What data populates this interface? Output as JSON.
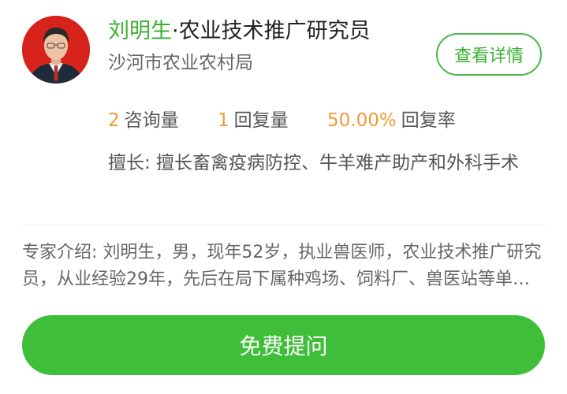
{
  "expert": {
    "name": "刘明生",
    "title": "·农业技术推广研究员",
    "organization": "沙河市农业农村局",
    "detail_button_label": "查看详情"
  },
  "stats": [
    {
      "value": "2",
      "label": "咨询量"
    },
    {
      "value": "1",
      "label": "回复量"
    },
    {
      "value": "50.00%",
      "label": "回复率"
    }
  ],
  "specialty": "擅长: 擅长畜禽疫病防控、牛羊难产助产和外科手术",
  "introduction": "专家介绍: 刘明生，男，现年52岁，执业兽医师，农业技术推广研究员，从业经验29年，先后在局下属种鸡场、饲料厂、兽医站等单位工作",
  "ask_button_label": "免费提问",
  "colors": {
    "accent": "#3cb034",
    "number": "#f19a38",
    "button": "#3fbe3a"
  }
}
